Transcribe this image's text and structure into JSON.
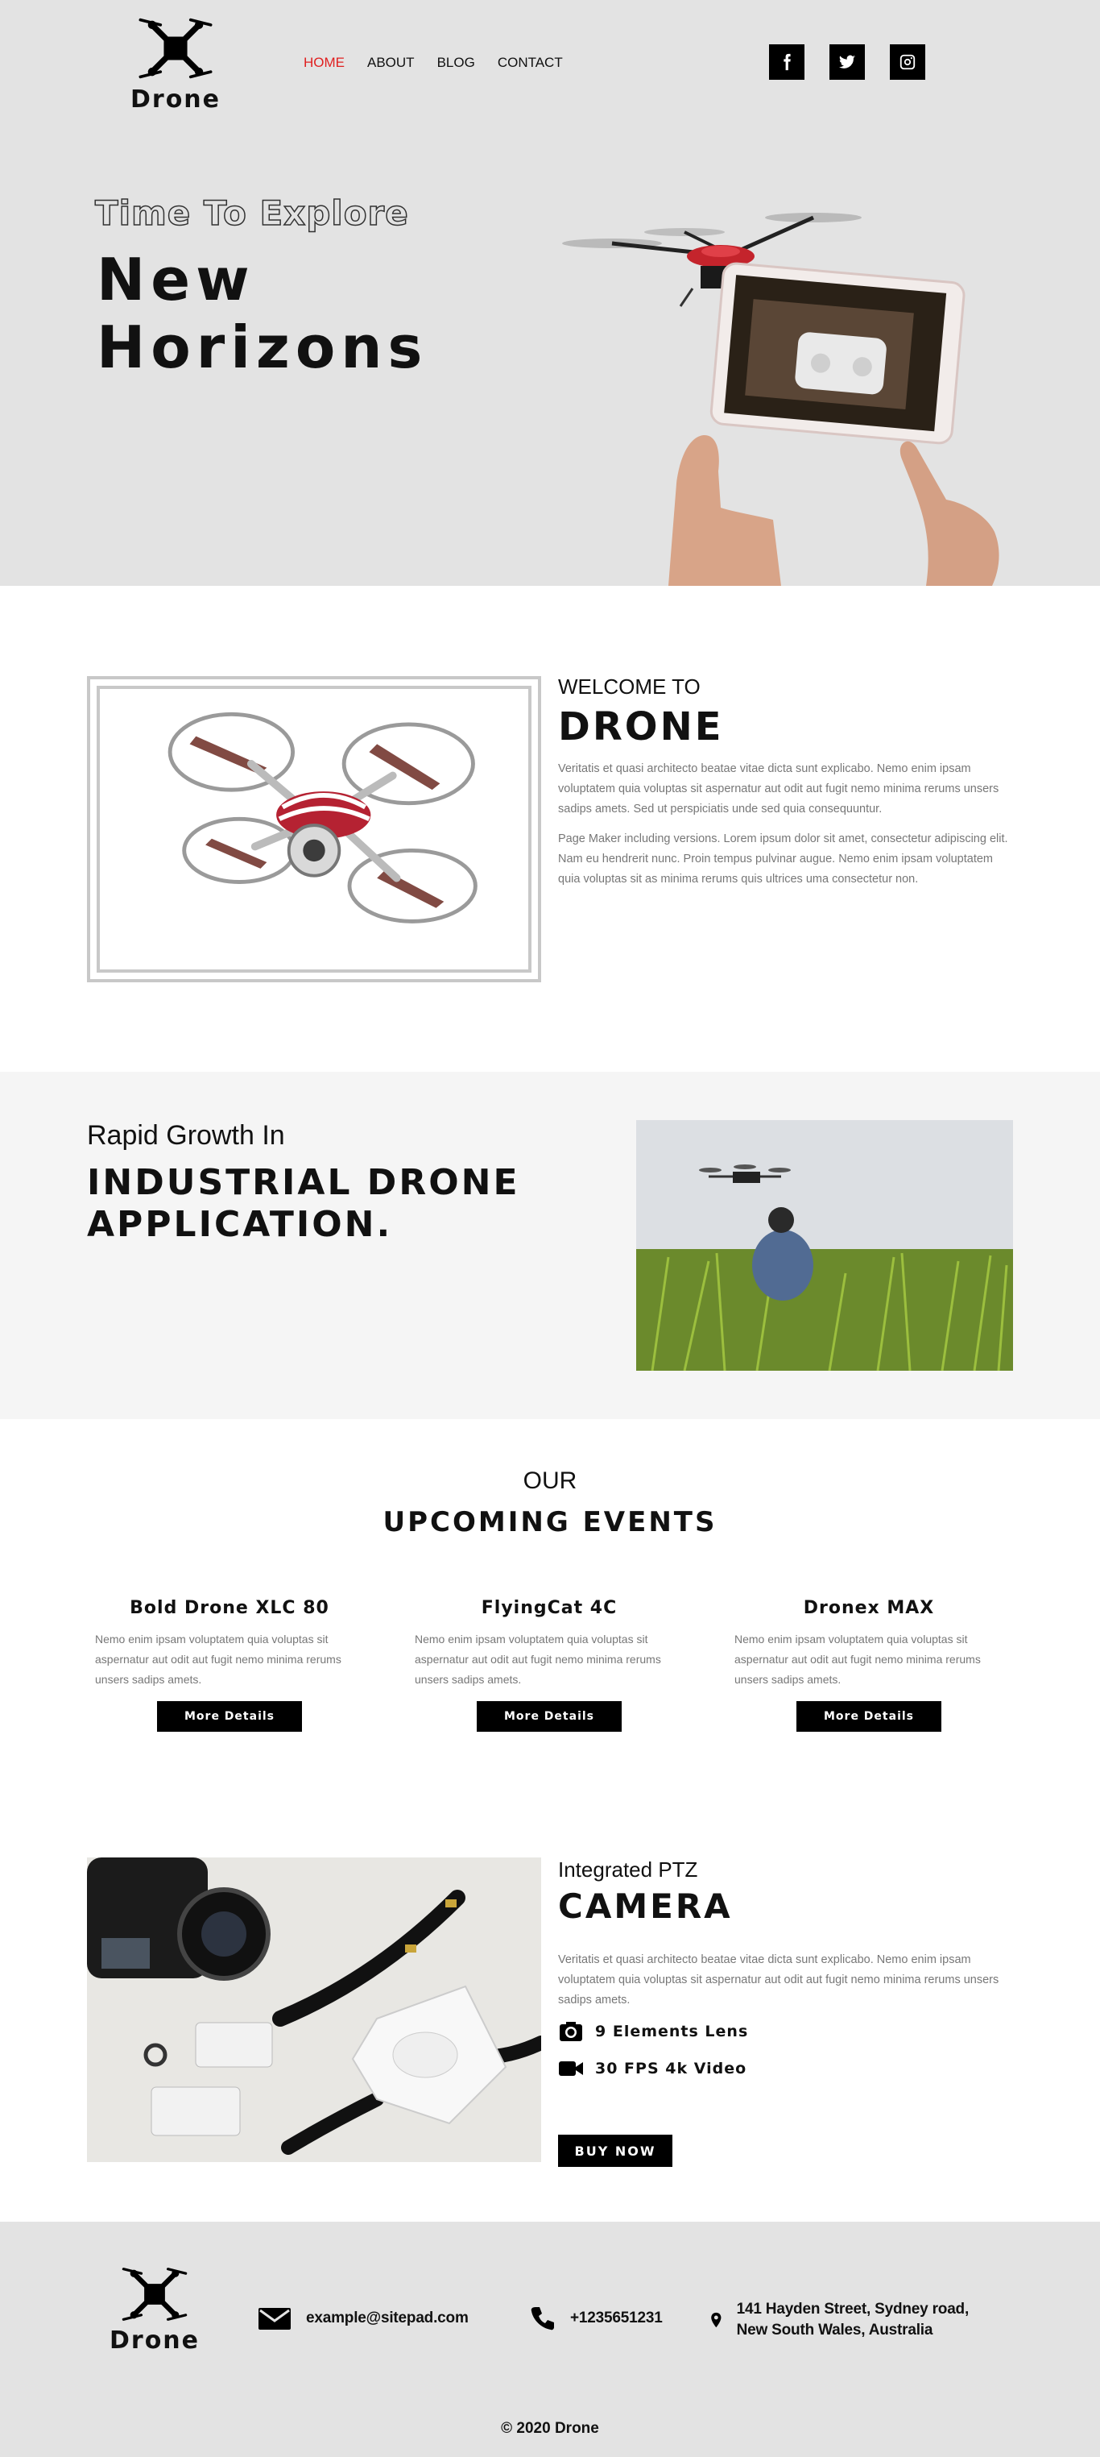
{
  "header": {
    "logo_text": "Drone",
    "nav": [
      "HOME",
      "ABOUT",
      "BLOG",
      "CONTACT"
    ],
    "active_nav": "HOME",
    "social": [
      "facebook-icon",
      "twitter-icon",
      "instagram-icon"
    ]
  },
  "hero": {
    "subtitle": "Time To Explore",
    "title_line1": "New",
    "title_line2": "Horizons"
  },
  "welcome": {
    "kicker": "WELCOME TO",
    "title": "DRONE",
    "para1": "Veritatis et quasi architecto beatae vitae dicta sunt explicabo. Nemo enim ipsam voluptatem quia voluptas sit aspernatur aut odit aut fugit nemo minima rerums unsers sadips amets. Sed ut perspiciatis unde sed quia consequuntur.",
    "para2": "Page Maker including versions. Lorem ipsum dolor sit amet, consectetur adipiscing elit. Nam eu hendrerit nunc. Proin tempus pulvinar augue. Nemo enim ipsam voluptatem quia voluptas sit as minima rerums quis ultrices uma consectetur non."
  },
  "industrial": {
    "kicker": "Rapid Growth In",
    "title": "INDUSTRIAL DRONE APPLICATION."
  },
  "events": {
    "kicker": "OUR",
    "title": "UPCOMING EVENTS",
    "cards": [
      {
        "title": "Bold Drone XLC 80",
        "text": "Nemo enim ipsam voluptatem quia voluptas sit aspernatur aut odit aut fugit nemo minima rerums unsers sadips amets.",
        "button": "More Details"
      },
      {
        "title": "FlyingCat 4C",
        "text": "Nemo enim ipsam voluptatem quia voluptas sit aspernatur aut odit aut fugit nemo minima rerums unsers sadips amets.",
        "button": "More Details"
      },
      {
        "title": "Dronex MAX",
        "text": "Nemo enim ipsam voluptatem quia voluptas sit aspernatur aut odit aut fugit nemo minima rerums unsers sadips amets.",
        "button": "More Details"
      }
    ]
  },
  "camera": {
    "kicker": "Integrated PTZ",
    "title": "CAMERA",
    "text": "Veritatis et quasi architecto beatae vitae dicta sunt explicabo. Nemo enim ipsam voluptatem quia voluptas sit aspernatur aut odit aut fugit nemo minima rerums unsers sadips amets.",
    "feature1": "9 Elements Lens",
    "feature2": "30 FPS 4k Video",
    "button": "BUY NOW"
  },
  "footer": {
    "logo_text": "Drone",
    "email": "example@sitepad.com",
    "phone": "+1235651231",
    "address": "141 Hayden Street, Sydney road, New South Wales, Australia",
    "copyright": "© 2020 Drone"
  }
}
